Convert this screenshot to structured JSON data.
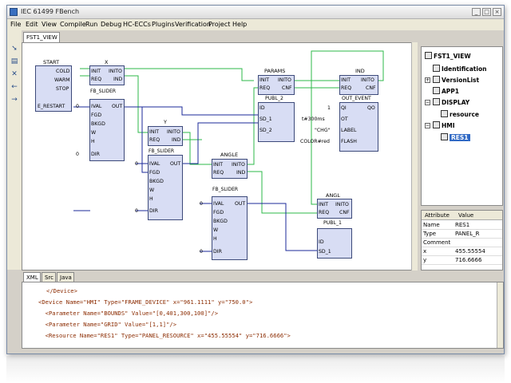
{
  "window": {
    "title": "IEC 61499 FBench"
  },
  "menu": [
    "File",
    "Edit",
    "View",
    "Compile",
    "Run",
    "Debug",
    "HC-ECCs",
    "Plugins",
    "Verification",
    "Project",
    "Help"
  ],
  "editor_tab": "FST1_VIEW",
  "diagram": {
    "start": {
      "title": "START",
      "events": [
        "COLD",
        "WARM",
        "STOP"
      ],
      "out": "E_RESTART"
    },
    "x": {
      "title": "X",
      "type": "FB_SLIDER",
      "ev_in": [
        "INIT",
        "REQ"
      ],
      "ev_out": [
        "INITO",
        "IND"
      ],
      "data_in": [
        "IVAL",
        "FGD",
        "BKGD",
        "W",
        "H",
        "DIR"
      ],
      "data_out": [
        "OUT"
      ]
    },
    "y": {
      "title": "Y",
      "type": "FB_SLIDER",
      "ev_in": [
        "INIT",
        "REQ"
      ],
      "ev_out": [
        "INITO",
        "IND"
      ],
      "data_in": [
        "IVAL",
        "FGD",
        "BKGD",
        "W",
        "H",
        "DIR"
      ],
      "data_out": [
        "OUT"
      ]
    },
    "angle": {
      "title": "ANGLE",
      "type": "FB_SLIDER",
      "ev_in": [
        "INIT",
        "REQ"
      ],
      "ev_out": [
        "INITO",
        "IND"
      ],
      "data_in": [
        "IVAL",
        "FGD",
        "BKGD",
        "W",
        "H",
        "DIR"
      ],
      "data_out": [
        "OUT"
      ]
    },
    "params": {
      "title": "PARAMS",
      "type": "PUBL_2",
      "ev_in": [
        "INIT",
        "REQ"
      ],
      "ev_out": [
        "INITO",
        "CNF"
      ],
      "data_in": [
        "ID",
        "SD_1",
        "SD_2"
      ]
    },
    "ind": {
      "title": "IND",
      "type": "OUT_EVENT",
      "ev_in": [
        "INIT",
        "REQ"
      ],
      "ev_out": [
        "INITO",
        "CNF"
      ],
      "data_in": [
        "QI",
        "OT",
        "LABEL",
        "FLASH"
      ],
      "data_out": [
        "QO"
      ]
    },
    "angl": {
      "title": "ANGL",
      "type": "PUBL_1",
      "ev_in": [
        "INIT",
        "REQ"
      ],
      "ev_out": [
        "INITO",
        "CNF"
      ],
      "data_in": [
        "ID",
        "SD_1"
      ]
    },
    "consts": {
      "zero": "0",
      "qi": "1",
      "ot": "t#300ms",
      "label": "\"CHG\"",
      "flash": "COLOR#red"
    }
  },
  "tree": {
    "root": "FST1_VIEW",
    "items": [
      "Identification",
      "VersionList",
      "APP1",
      "DISPLAY",
      "resource",
      "HMI",
      "RES1"
    ],
    "selected": "RES1"
  },
  "properties": {
    "headers": [
      "Attribute",
      "Value"
    ],
    "rows": [
      {
        "attr": "Name",
        "value": "RES1"
      },
      {
        "attr": "Type",
        "value": "PANEL_R"
      },
      {
        "attr": "Comment",
        "value": ""
      },
      {
        "attr": "x",
        "value": "455.55554"
      },
      {
        "attr": "y",
        "value": "716.6666"
      }
    ]
  },
  "bottom_tabs": [
    "XML",
    "Src",
    "Java"
  ],
  "xml_lines": [
    "</Device>",
    "<Device Name=\"HMI\" Type=\"FRAME_DEVICE\" x=\"961.1111\" y=\"750.0\">",
    "  <Parameter Name=\"BOUNDS\" Value=\"[0,401,300,100]\"/>",
    "  <Parameter Name=\"GRID\" Value=\"[1,1]\"/>",
    "  <Resource Name=\"RES1\" Type=\"PANEL_RESOURCE\" x=\"455.55554\" y=\"716.6666\">"
  ],
  "colors": {
    "fb_fill": "#d8ddf4",
    "event_wire": "#2db84a",
    "data_wire": "#1b2a9a",
    "selection": "#316ac5"
  }
}
